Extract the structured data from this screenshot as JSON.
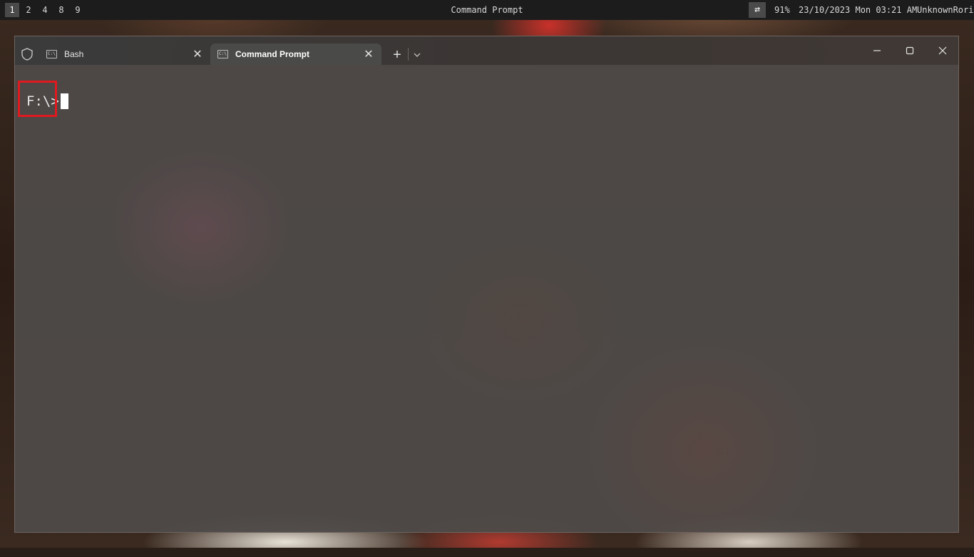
{
  "topbar": {
    "workspaces": [
      "1",
      "2",
      "4",
      "8",
      "9"
    ],
    "active_workspace": "1",
    "window_title": "Command Prompt",
    "layout_icon": "⇄",
    "battery": "91%",
    "datetime": "23/10/2023 Mon 03:21 AM",
    "user": "UnknownRori"
  },
  "tabs": [
    {
      "label": "Bash",
      "icon": "cmd-icon",
      "active": false
    },
    {
      "label": "Command Prompt",
      "icon": "cmd-icon",
      "active": true
    }
  ],
  "tab_icon_text": "C:\\",
  "terminal": {
    "prompt": "F:\\>"
  },
  "colors": {
    "highlight": "#e0191f",
    "terminal_bg": "#4e4a48",
    "text": "#e8e8e8"
  }
}
